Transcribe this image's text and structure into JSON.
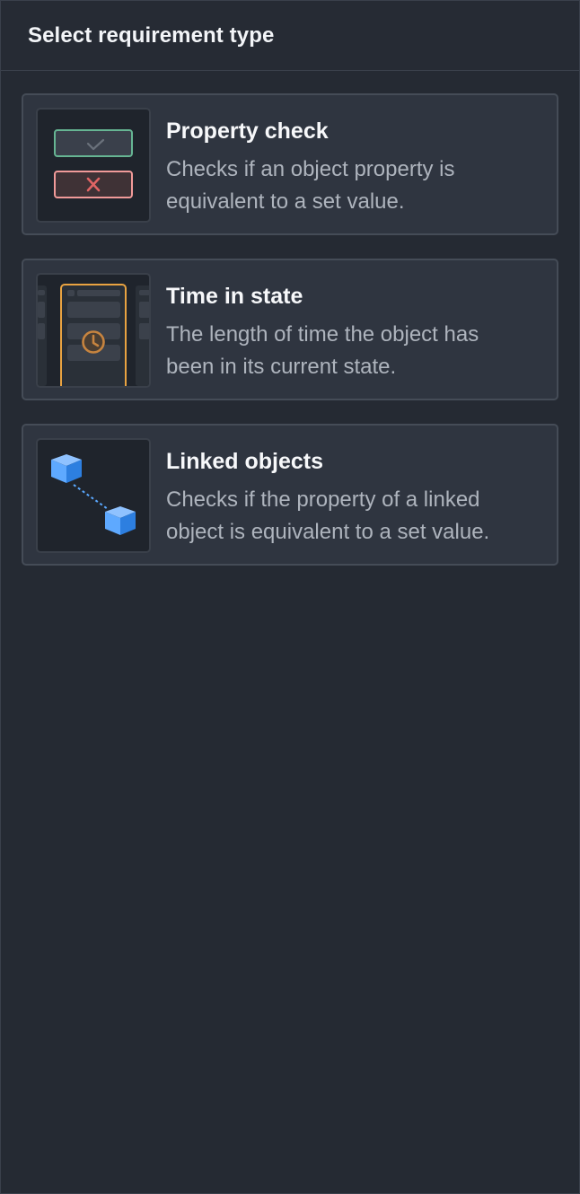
{
  "header": {
    "title": "Select requirement type"
  },
  "options": [
    {
      "title": "Property check",
      "description": "Checks if an object property is equivalent to a set value.",
      "illustration": "property-check-illustration"
    },
    {
      "title": "Time in state",
      "description": "The length of time the object has been in its current state.",
      "illustration": "time-in-state-illustration"
    },
    {
      "title": "Linked objects",
      "description": "Checks if the property of a linked object is equivalent to a set value.",
      "illustration": "linked-objects-illustration"
    }
  ],
  "colors": {
    "background": "#252a33",
    "card": "#2f3540",
    "success": "#5ed19b",
    "danger": "#ff6b6b",
    "accent_orange": "#f2a33a",
    "accent_blue": "#4a9cff"
  }
}
